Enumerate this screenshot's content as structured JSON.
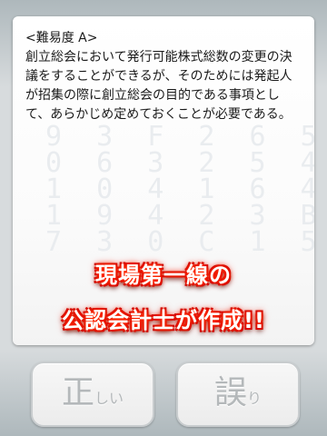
{
  "question": {
    "difficulty": "<難易度 A>",
    "text": "創立総会において発行可能株式総数の変更の決議をすることができるが、そのためには発起人が招集の際に創立総会の目的である事項として、あらかじめ定めておくことが必要である。"
  },
  "background_digits": "9 3 F 2 6 5\n0 6 3 2 5 4 7 9\n1 0 4 1 6 4 D 3\n1 9 4 2 3 B 2 6\n7 3 0 C 1 5 7 1",
  "banners": {
    "line1": "現場第一線の",
    "line2": "公認会計士が作成!!"
  },
  "answer_buttons": {
    "correct": {
      "big": "正",
      "small": "しい"
    },
    "wrong": {
      "big": "誤",
      "small": "り"
    }
  },
  "colors": {
    "banner_glow": "#ff2a00",
    "button_text": "#b4b8ba"
  }
}
